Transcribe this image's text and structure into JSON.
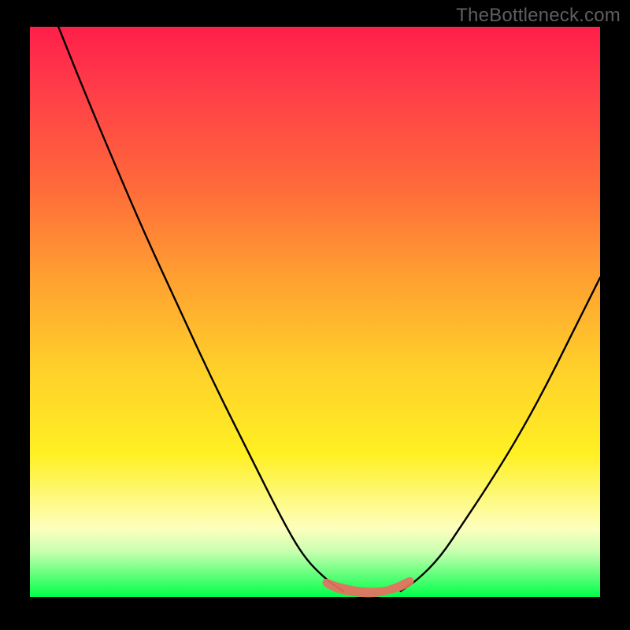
{
  "watermark": "TheBottleneck.com",
  "chart_data": {
    "type": "line",
    "title": "",
    "xlabel": "",
    "ylabel": "",
    "xlim": [
      0,
      100
    ],
    "ylim": [
      0,
      100
    ],
    "grid": false,
    "legend": false,
    "series": [
      {
        "name": "left-curve-black",
        "color": "#000000",
        "x": [
          5,
          9,
          14,
          20,
          26,
          32,
          38,
          44,
          48,
          52,
          55
        ],
        "y": [
          100,
          90,
          78,
          64,
          51,
          38,
          26,
          14,
          7,
          3,
          1
        ]
      },
      {
        "name": "right-curve-black",
        "color": "#000000",
        "x": [
          65,
          68,
          72,
          76,
          80,
          85,
          90,
          95,
          100
        ],
        "y": [
          1,
          3,
          7,
          13,
          19,
          27,
          36,
          46,
          56
        ]
      },
      {
        "name": "valley-red-band",
        "color": "#e86f61",
        "x": [
          52,
          54,
          56,
          58,
          60,
          62,
          64,
          66,
          67,
          65,
          63,
          61,
          59,
          57,
          55,
          53,
          52
        ],
        "y": [
          2.5,
          1.8,
          1.3,
          1.0,
          0.9,
          1.0,
          1.4,
          2.2,
          3.0,
          2.0,
          1.2,
          0.7,
          0.6,
          0.8,
          1.1,
          1.8,
          2.5
        ]
      }
    ],
    "background_gradient": {
      "direction": "vertical",
      "stops": [
        {
          "pos": 0.0,
          "color": "#ff1f4a"
        },
        {
          "pos": 0.1,
          "color": "#ff3a49"
        },
        {
          "pos": 0.28,
          "color": "#ff6a3a"
        },
        {
          "pos": 0.45,
          "color": "#ffa330"
        },
        {
          "pos": 0.6,
          "color": "#ffd02a"
        },
        {
          "pos": 0.75,
          "color": "#fff023"
        },
        {
          "pos": 0.88,
          "color": "#fdffbd"
        },
        {
          "pos": 0.92,
          "color": "#c9ffb0"
        },
        {
          "pos": 1.0,
          "color": "#00ff4a"
        }
      ]
    }
  },
  "colors": {
    "frame": "#000000",
    "watermark": "#5f5f5f",
    "curve": "#000000",
    "valley": "#e86f61"
  }
}
